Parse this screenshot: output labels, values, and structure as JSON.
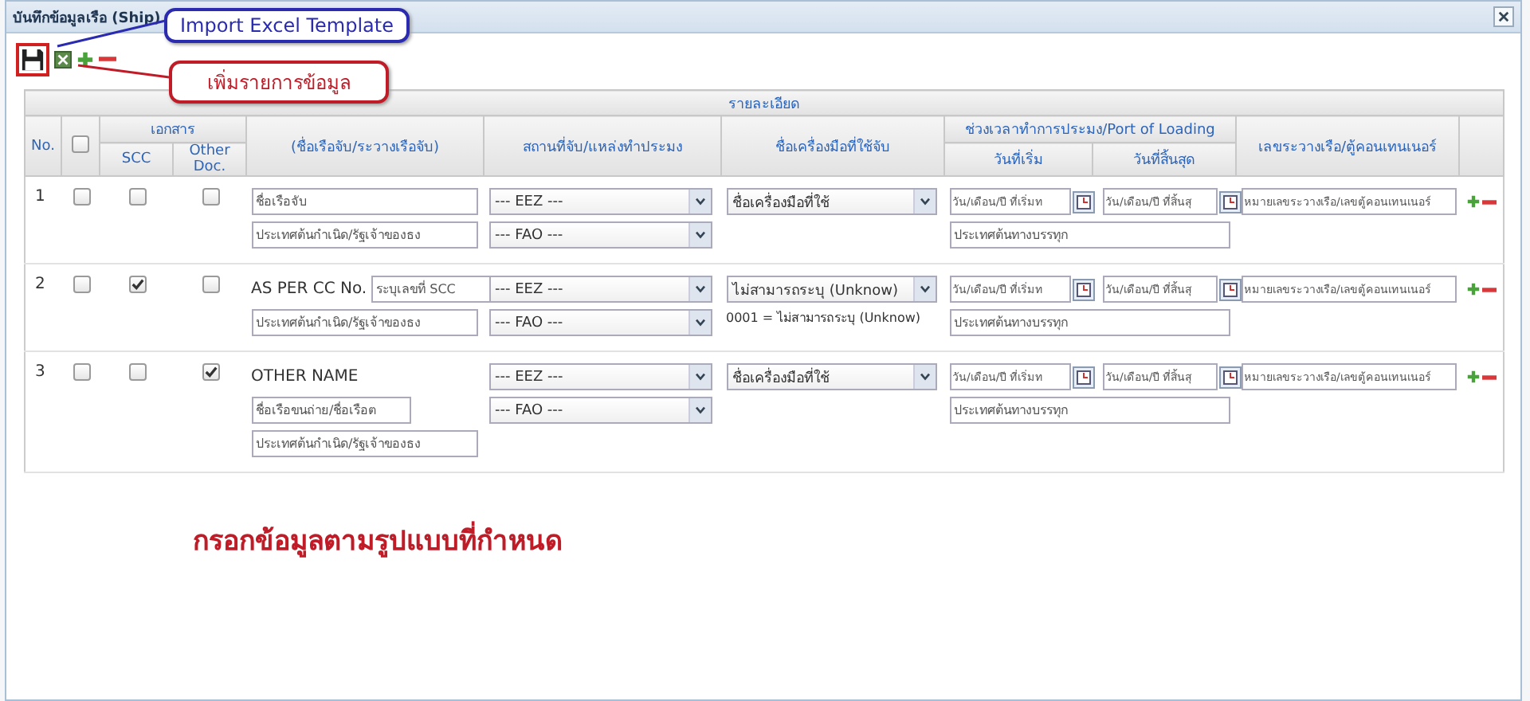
{
  "dialog": {
    "title": "บันทึกข้อมูลเรือ (Ship)"
  },
  "callouts": [
    {
      "text": "Import Excel Template",
      "color": "#2b2bb0"
    },
    {
      "text": "เพิ่มรายการข้อมูล",
      "color": "#c01c28"
    }
  ],
  "table": {
    "group_heading": "รายละเอียด",
    "no": "No.",
    "all_checked": false,
    "documents": "เอกสาร",
    "scc": "SCC",
    "other_doc": "Other Doc.",
    "vessel": "(ชื่อเรือจับ/ระวางเรือจับ)",
    "place": "สถานที่จับ/แหล่งทำประมง",
    "gear": "ชื่อเครื่องมือที่ใช้จับ",
    "period": "ช่วงเวลาทำการประมง/Port of Loading",
    "start": "วันที่เริ่ม",
    "end": "วันที่สิ้นสุด",
    "container": "เลขระวางเรือ/ตู้คอนเทนเนอร์",
    "rows": [
      {
        "no": "1",
        "checked": false,
        "scc": false,
        "other_doc": false,
        "vessel_placeholder": "ชื่อเรือจับ",
        "origin_placeholder": "ประเทศต้นกำเนิด/รัฐเจ้าของธง",
        "eez": "--- EEZ ---",
        "fao": "--- FAO ---",
        "gear": "ชื่อเครื่องมือที่ใช้",
        "start_placeholder": "วัน/เดือน/ปี ที่เริ่มท",
        "end_placeholder": "วัน/เดือน/ปี ที่สิ้นสุ",
        "loading_placeholder": "ประเทศต้นทางบรรทุก",
        "container_placeholder": "หมายเลขระวางเรือ/เลขตู้คอนเทนเนอร์"
      },
      {
        "no": "2",
        "checked": false,
        "scc": true,
        "other_doc": false,
        "vessel_label": "AS PER CC No.",
        "vessel_placeholder": "ระบุเลขที่ SCC",
        "origin_placeholder": "ประเทศต้นกำเนิด/รัฐเจ้าของธง",
        "eez": "--- EEZ ---",
        "fao": "--- FAO ---",
        "gear": "ไม่สามารถระบุ (Unknow)",
        "gear_note": "0001 = ไม่สามารถระบุ (Unknow)",
        "start_placeholder": "วัน/เดือน/ปี ที่เริ่มท",
        "end_placeholder": "วัน/เดือน/ปี ที่สิ้นสุ",
        "loading_placeholder": "ประเทศต้นทางบรรทุก",
        "container_placeholder": "หมายเลขระวางเรือ/เลขตู้คอนเทนเนอร์"
      },
      {
        "no": "3",
        "checked": false,
        "scc": false,
        "other_doc": true,
        "vessel_label": "OTHER NAME",
        "vessel_placeholder": "ชื่อเรือขนถ่าย/ชื่อเรือต",
        "origin_placeholder": "ประเทศต้นกำเนิด/รัฐเจ้าของธง",
        "eez": "--- EEZ ---",
        "fao": "--- FAO ---",
        "gear": "ชื่อเครื่องมือที่ใช้",
        "start_placeholder": "วัน/เดือน/ปี ที่เริ่มท",
        "end_placeholder": "วัน/เดือน/ปี ที่สิ้นสุ",
        "loading_placeholder": "ประเทศต้นทางบรรทุก",
        "container_placeholder": "หมายเลขระวางเรือ/เลขตู้คอนเทนเนอร์"
      }
    ]
  },
  "note": "กรอกข้อมูลตามรูปแบบที่กำหนด"
}
